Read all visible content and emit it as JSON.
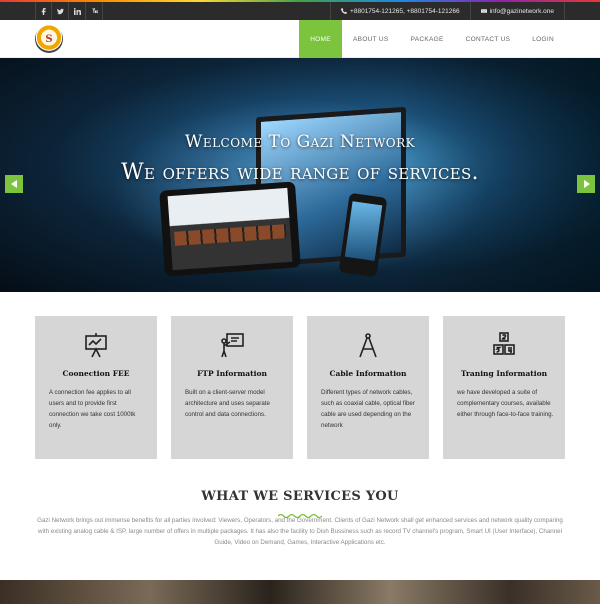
{
  "social": {
    "icons": [
      "facebook-icon",
      "twitter-icon",
      "linkedin-icon",
      "youtube-icon"
    ]
  },
  "contact": {
    "phone": "+8801754-121265, +8801754-121266",
    "email": "info@gazinetwork.one"
  },
  "logo": {
    "text": "S"
  },
  "nav": {
    "items": [
      "HOME",
      "ABOUT US",
      "PACKAGE",
      "CONTACT US",
      "LOGIN"
    ],
    "active": "HOME"
  },
  "hero": {
    "title": "Welcome To Gazi Network",
    "subtitle": "We offers wide range of services."
  },
  "services": [
    {
      "icon": "presentation-board-icon",
      "title": "Coonection FEE",
      "text": "A connection fee applies to all users and to provide first connection we take cost 1000tk only."
    },
    {
      "icon": "whiteboard-teacher-icon",
      "title": "FTP Information",
      "text": "Built on a client-server model architecture and uses separate control and data connections."
    },
    {
      "icon": "drafting-compass-icon",
      "title": "Cable Information",
      "text": "Different types of network cables, such as coaxial cable, optical fiber cable are used depending on the network"
    },
    {
      "icon": "numbered-blocks-icon",
      "title": "Traning Information",
      "text": "we have developed a suite of complementary courses, available either through face-to-face training."
    }
  ],
  "section": {
    "title": "WHAT WE SERVICES YOU",
    "text": "Gazi Network brings out immense benefits for all parties involved: Viewers, Operators, and the Government. Clients of Gazi Network shall get enhanced services and network quality comparing with existing analog cable & ISP, large number of offers in multiple packages. It has also the facility to Dish Bussiness such as record TV channel's program, Smart UI (User Interface), Channel Guide, Video on Demand, Games, Interactive Applications etc."
  },
  "colors": {
    "accent": "#7cc33e",
    "topbar": "#2b2b2b",
    "card": "#d6d6d6"
  }
}
